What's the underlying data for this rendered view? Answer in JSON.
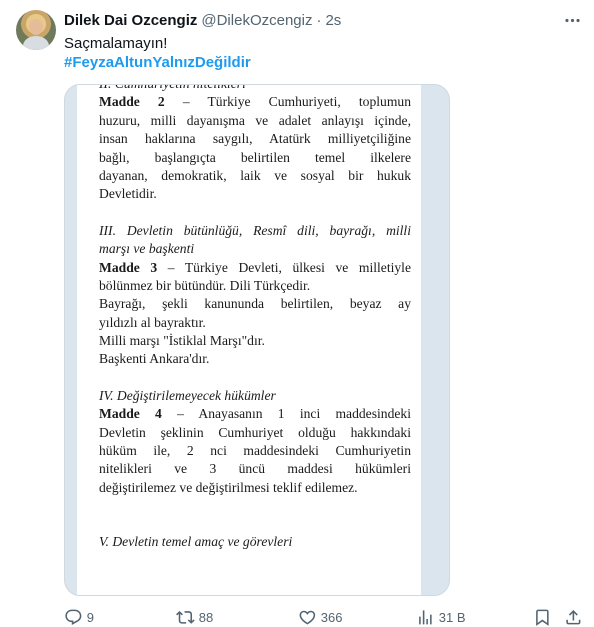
{
  "tweet": {
    "author_name": "Dilek Dai Ozcengiz",
    "handle": "@DilekOzcengiz",
    "separator": "·",
    "time": "2s",
    "text": "Saçmalamayın!",
    "hashtag": "#FeyzaAltunYalnızDeğildir"
  },
  "document": {
    "lines": [
      {
        "text": "II. Cumhuriyetin nitelikleri",
        "style": "it"
      },
      {
        "bold": "Madde 2",
        "text": " – Türkiye Cumhuriyeti, toplumun",
        "style": "just"
      },
      {
        "text": "huzuru, milli dayanışma ve adalet anlayışı içinde,",
        "style": "just"
      },
      {
        "text": "insan haklarına saygılı, Atatürk milliyetçiliğine",
        "style": "just"
      },
      {
        "text": "bağlı, başlangıçta belirtilen temel ilkelere",
        "style": "just"
      },
      {
        "text": "dayanan, demokratik, laik ve sosyal bir hukuk",
        "style": "just"
      },
      {
        "text": "Devletidir.",
        "style": ""
      },
      {
        "gap": true
      },
      {
        "text": "III. Devletin bütünlüğü, Resmî dili, bayrağı, milli",
        "style": "it just"
      },
      {
        "text": "marşı ve başkenti",
        "style": "it"
      },
      {
        "bold": "Madde 3",
        "text": " – Türkiye Devleti, ülkesi ve milletiyle",
        "style": "just"
      },
      {
        "text": "bölünmez bir bütündür. Dili Türkçedir.",
        "style": ""
      },
      {
        "text": "Bayrağı, şekli kanununda belirtilen, beyaz ay",
        "style": "just"
      },
      {
        "text": "yıldızlı al bayraktır.",
        "style": ""
      },
      {
        "text": "Milli marşı \"İstiklal Marşı\"dır.",
        "style": ""
      },
      {
        "text": "Başkenti Ankara'dır.",
        "style": ""
      },
      {
        "gap": true
      },
      {
        "text": "IV. Değiştirilemeyecek hükümler",
        "style": "it"
      },
      {
        "bold": "Madde 4",
        "text": " – Anayasanın 1 inci maddesindeki",
        "style": "just"
      },
      {
        "text": "Devletin şeklinin Cumhuriyet olduğu hakkındaki",
        "style": "just"
      },
      {
        "text": "hüküm ile, 2 nci maddesindeki Cumhuriyetin",
        "style": "just"
      },
      {
        "text": "nitelikleri ve 3 üncü maddesi hükümleri",
        "style": "just"
      },
      {
        "text": "değiştirilemez ve değiştirilmesi teklif edilemez.",
        "style": ""
      },
      {
        "gap": true
      },
      {
        "gap": true
      },
      {
        "text": "V. Devletin temel amaç ve görevleri",
        "style": "it"
      }
    ]
  },
  "actions": {
    "replies": "9",
    "reposts": "88",
    "likes": "366",
    "views": "31 B"
  },
  "icons": {
    "reply": "reply-icon",
    "repost": "repost-icon",
    "like": "heart-icon",
    "views": "views-icon",
    "bookmark": "bookmark-icon",
    "share": "share-icon",
    "more": "more-icon"
  }
}
